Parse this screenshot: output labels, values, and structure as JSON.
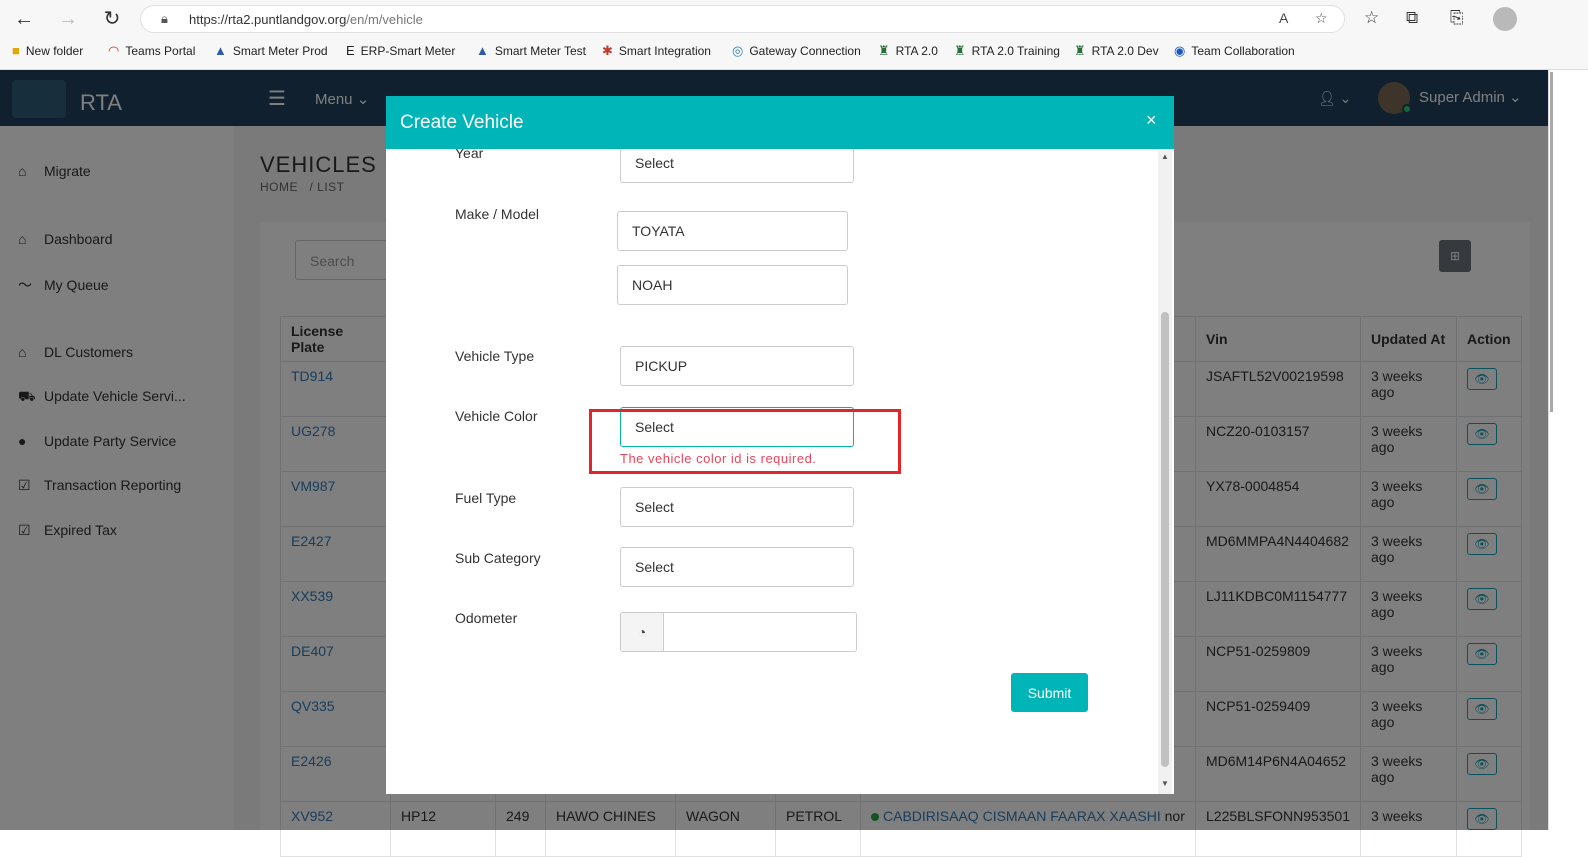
{
  "browser": {
    "url_host": "https://rta2.puntlandgov.org",
    "url_path": "/en/m/vehicle",
    "bookmarks": [
      "New folder",
      "Teams Portal",
      "Smart Meter Prod",
      "ERP-Smart Meter",
      "Smart Meter Test",
      "Smart Integration",
      "Gateway Connection",
      "RTA 2.0",
      "RTA 2.0 Training",
      "RTA 2.0 Dev",
      "Team Collaboration"
    ]
  },
  "header": {
    "app_name": "RTA",
    "menu_label": "Menu ⌄",
    "user_name": "Super Admin ⌄"
  },
  "sidebar": {
    "items": [
      {
        "label": "Migrate",
        "icon": "home-icon"
      },
      {
        "label": "Dashboard",
        "icon": "home-icon"
      },
      {
        "label": "My Queue",
        "icon": "chart-line-icon"
      },
      {
        "label": "DL Customers",
        "icon": "home-icon"
      },
      {
        "label": "Update Vehicle Servi...",
        "icon": "car-icon"
      },
      {
        "label": "Update Party Service",
        "icon": "user-icon"
      },
      {
        "label": "Transaction Reporting",
        "icon": "check-square-icon"
      },
      {
        "label": "Expired Tax",
        "icon": "check-square-icon"
      }
    ]
  },
  "page": {
    "title": "VEHICLES",
    "breadcrumb": "HOME   / LIST",
    "search_placeholder": "Search",
    "grid_button": "⊞"
  },
  "table": {
    "headers": [
      "License Plate",
      "Vin",
      "Updated At",
      "Action"
    ],
    "rows": [
      {
        "plate": "TD914",
        "vin": "JSAFTL52V00219598",
        "updated": "3 weeks",
        "updated2": "ago"
      },
      {
        "plate": "UG278",
        "vin": "NCZ20-0103157",
        "updated": "3 weeks",
        "updated2": "ago"
      },
      {
        "plate": "VM987",
        "vin": "YX78-0004854",
        "updated": "3 weeks",
        "updated2": "ago"
      },
      {
        "plate": "E2427",
        "vin": "MD6MMPA4N4404682",
        "updated": "3 weeks",
        "updated2": "ago"
      },
      {
        "plate": "XX539",
        "vin": "LJ11KDBC0M1154777",
        "updated": "3 weeks",
        "updated2": "ago"
      },
      {
        "plate": "DE407",
        "vin": "NCP51-0259809",
        "updated": "3 weeks",
        "updated2": "ago"
      },
      {
        "plate": "QV335",
        "vin": "NCP51-0259409",
        "updated": "3 weeks",
        "updated2": "ago"
      },
      {
        "plate": "E2426",
        "vin": "MD6M14P6N4A04652",
        "updated": "3 weeks",
        "updated2": "ago"
      }
    ],
    "last_row": {
      "plate": "XV952",
      "c1": "HP12",
      "c2": "249",
      "make": "HAWO CHINES",
      "type": "WAGON",
      "fuel": "PETROL",
      "owner": "CABDIRISAAQ CISMAAN FAARAX XAASHI",
      "owner_suffix": " nor",
      "vin": "L225BLSFONN953501",
      "updated": "3 weeks"
    }
  },
  "modal": {
    "title": "Create Vehicle",
    "close": "×",
    "fields": {
      "year_label": "Year",
      "year_value": "Select",
      "make_label": "Make / Model",
      "make_value": "TOYATA",
      "model_value": "NOAH",
      "type_label": "Vehicle Type",
      "type_value": "PICKUP",
      "color_label": "Vehicle Color",
      "color_value": "Select",
      "color_error": "The vehicle color id is required.",
      "fuel_label": "Fuel Type",
      "fuel_value": "Select",
      "subcat_label": "Sub Category",
      "subcat_value": "Select",
      "odometer_label": "Odometer",
      "odometer_value": ""
    },
    "submit": "Submit"
  }
}
